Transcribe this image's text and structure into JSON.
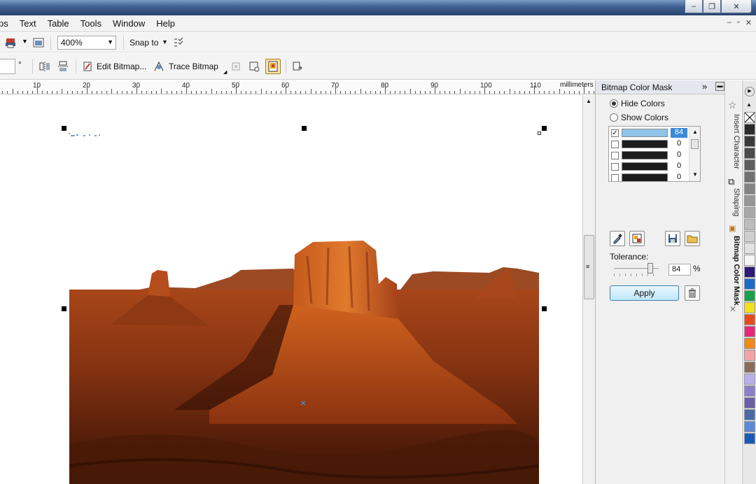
{
  "window": {
    "minimize": "–",
    "restore": "❐",
    "close": "✕"
  },
  "menu": {
    "items": [
      "ps",
      "Text",
      "Table",
      "Tools",
      "Window",
      "Help"
    ],
    "mdi": [
      "–",
      "▫",
      "✕"
    ]
  },
  "toolbar1": {
    "zoom_value": "400%",
    "snap_to_label": "Snap to"
  },
  "toolbar2": {
    "angle_unit": "°",
    "edit_bitmap_label": "Edit Bitmap...",
    "trace_bitmap_label": "Trace Bitmap"
  },
  "ruler": {
    "labels": [
      "10",
      "20",
      "30",
      "40",
      "50",
      "60",
      "70",
      "80",
      "90",
      "100",
      "110"
    ],
    "unit": "millimeters"
  },
  "docker": {
    "title": "Bitmap Color Mask",
    "hide_colors_label": "Hide Colors",
    "show_colors_label": "Show Colors",
    "selected_mode": "Hide Colors",
    "colors": [
      {
        "checked": true,
        "color": "#8fc3ea",
        "value": "84"
      },
      {
        "checked": false,
        "color": "#1c1c1c",
        "value": "0"
      },
      {
        "checked": false,
        "color": "#1c1c1c",
        "value": "0"
      },
      {
        "checked": false,
        "color": "#1c1c1c",
        "value": "0"
      },
      {
        "checked": false,
        "color": "#1c1c1c",
        "value": "0"
      }
    ],
    "tolerance_label": "Tolerance:",
    "tolerance_value": "84",
    "tolerance_unit": "%",
    "apply_label": "Apply"
  },
  "side_tabs": [
    "Insert Character",
    "Shaping",
    "Bitmap Color Mask"
  ],
  "palette_colors": [
    "#ffffff",
    "#2b2b2b",
    "#3a3a3a",
    "#4c4c4c",
    "#5e5e5e",
    "#707070",
    "#838383",
    "#969696",
    "#a9a9a9",
    "#bcbcbc",
    "#cfcfcf",
    "#e2e2e2",
    "#f5f5f5",
    "#2e1a78",
    "#1a6cc8",
    "#1aa04a",
    "#f0e020",
    "#e84a1a",
    "#e8287a",
    "#f08a1a",
    "#f3a3a3",
    "#8c6a5a",
    "#b8b0e8",
    "#8a7fc8",
    "#6a5fa8",
    "#4a6aa8",
    "#5a8ad8",
    "#1a5ab8"
  ],
  "colors": {
    "accent": "#3c7fb1",
    "selection_handle": "#000000"
  }
}
